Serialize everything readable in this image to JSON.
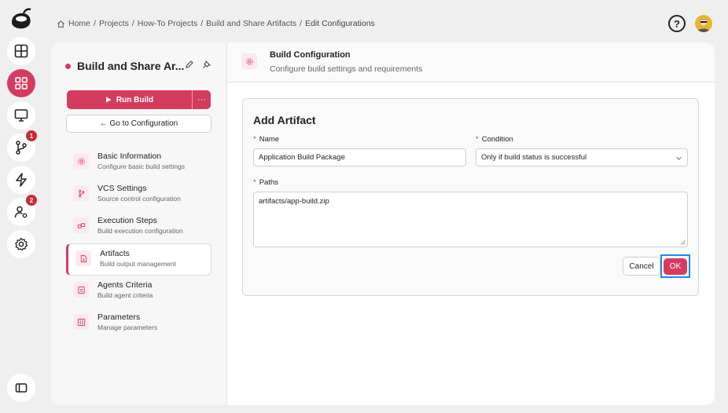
{
  "colors": {
    "accent": "#d43c5f",
    "focus": "#1e88e5",
    "badge": "#c82c35"
  },
  "rail": {
    "items": [
      {
        "icon": "dashboard-icon"
      },
      {
        "icon": "projects-icon",
        "active": true
      },
      {
        "icon": "monitor-icon"
      },
      {
        "icon": "branch-icon",
        "badge": "1"
      },
      {
        "icon": "lightning-icon"
      },
      {
        "icon": "user-gear-icon",
        "badge": "2"
      },
      {
        "icon": "gear-icon"
      }
    ],
    "collapse_icon": "sidebar-toggle-icon"
  },
  "breadcrumb": {
    "items": [
      "Home",
      "Projects",
      "How-To Projects",
      "Build and Share Artifacts",
      "Edit Configurations"
    ],
    "separator": "/"
  },
  "topbar": {
    "help_label": "?"
  },
  "sidebar": {
    "title": "Build and Share Ar...",
    "run_label": "Run Build",
    "more_label": "···",
    "goto_label": "← Go to Configuration",
    "items": [
      {
        "title": "Basic Information",
        "subtitle": "Configure basic build settings",
        "icon": "gear-icon"
      },
      {
        "title": "VCS Settings",
        "subtitle": "Source control configuration",
        "icon": "branch-icon"
      },
      {
        "title": "Execution Steps",
        "subtitle": "Build execution configuration",
        "icon": "steps-icon"
      },
      {
        "title": "Artifacts",
        "subtitle": "Build output management",
        "icon": "file-icon",
        "active": true
      },
      {
        "title": "Agents Criteria",
        "subtitle": "Build agent criteria",
        "icon": "agent-icon"
      },
      {
        "title": "Parameters",
        "subtitle": "Manage parameters",
        "icon": "parameters-icon"
      }
    ]
  },
  "config": {
    "title": "Build Configuration",
    "subtitle": "Configure build settings and requirements"
  },
  "form": {
    "title": "Add Artifact",
    "required_mark": "*",
    "name_label": "Name",
    "name_value": "Application Build Package",
    "condition_label": "Condition",
    "condition_value": "Only if build status is successful",
    "paths_label": "Paths",
    "paths_value": "artifacts/app-build.zip",
    "cancel_label": "Cancel",
    "ok_label": "OK"
  }
}
